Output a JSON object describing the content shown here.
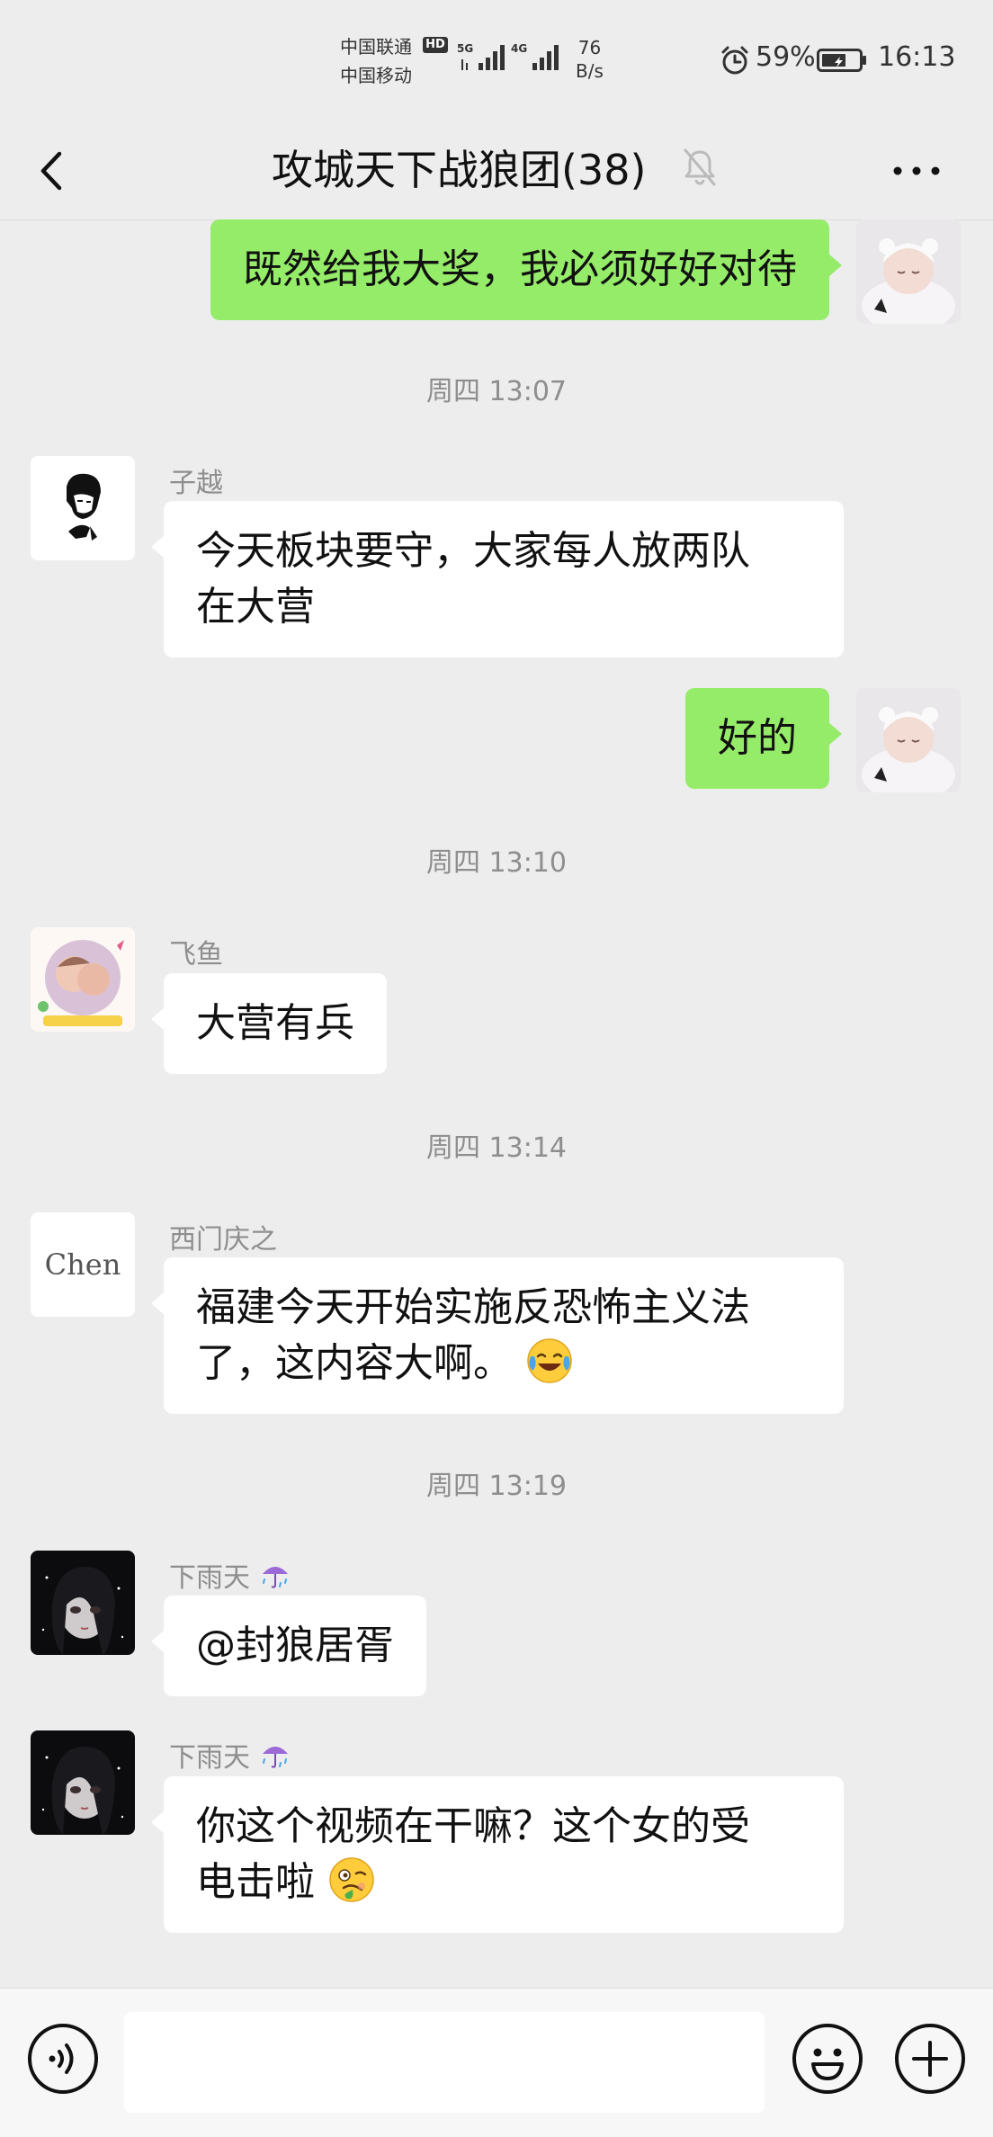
{
  "status_bar": {
    "carrier_1": "中国联通",
    "carrier_2": "中国移动",
    "hd_badge": "HD",
    "signal_1": "5G",
    "signal_2": "4G",
    "net_speed_value": "76",
    "net_speed_unit": "B/s",
    "battery": "59%",
    "time": "16:13",
    "icons": [
      "alarm-icon",
      "battery-icon",
      "signal-icon"
    ]
  },
  "nav": {
    "title": "攻城天下战狼团(38)",
    "icons": [
      "back-icon",
      "mute-icon",
      "more-icon"
    ]
  },
  "messages": [
    {
      "type": "outgoing",
      "text": "既然给我大奖，我必须好好对待"
    },
    {
      "type": "time",
      "text": "周四 13:07"
    },
    {
      "type": "incoming",
      "sender": "子越",
      "text_lines": [
        "今天板块要守，大家每人放两队",
        "在大营"
      ]
    },
    {
      "type": "outgoing",
      "text": "好的"
    },
    {
      "type": "time",
      "text": "周四 13:10"
    },
    {
      "type": "incoming",
      "sender": "飞鱼",
      "text": "大营有兵"
    },
    {
      "type": "time",
      "text": "周四 13:14"
    },
    {
      "type": "incoming",
      "sender": "西门庆之",
      "avatar_text": "Chen",
      "text_lines": [
        "福建今天开始实施反恐怖主义法",
        "了，这内容大啊。"
      ],
      "emoji": "laughing-crying-emoji"
    },
    {
      "type": "time",
      "text": "周四 13:19"
    },
    {
      "type": "incoming",
      "sender": "下雨天",
      "sender_emoji": "umbrella-rain-emoji",
      "text": "@封狼居胥"
    },
    {
      "type": "incoming",
      "sender": "下雨天",
      "sender_emoji": "umbrella-rain-emoji",
      "text_lines": [
        "你这个视频在干嘛？这个女的受",
        "电击啦"
      ],
      "emoji": "woozy-face-emoji"
    }
  ],
  "input_bar": {
    "icons": [
      "voice-icon",
      "emoji-icon",
      "plus-icon"
    ],
    "placeholder": ""
  },
  "colors": {
    "outgoing_bubble": "#95ec69",
    "incoming_bubble": "#ffffff",
    "background": "#ededed"
  }
}
